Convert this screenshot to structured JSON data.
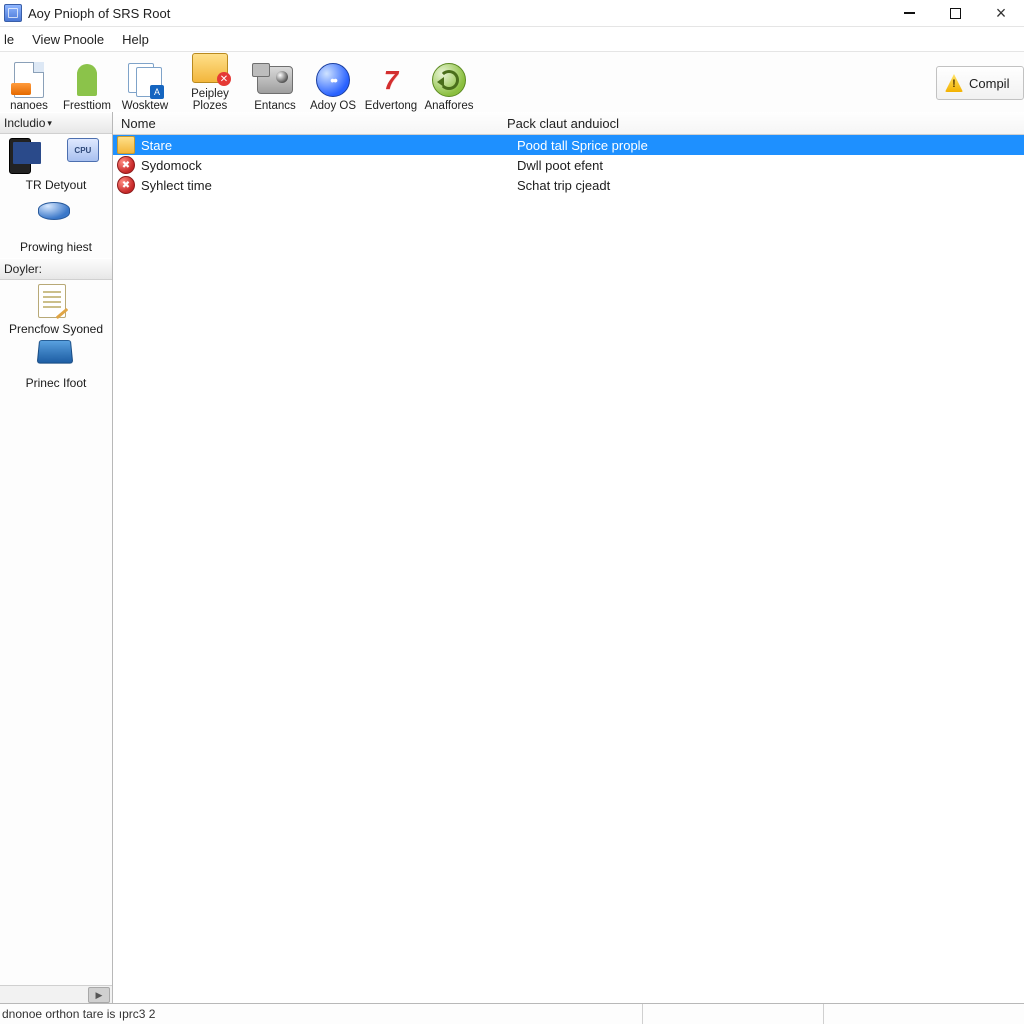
{
  "window": {
    "title": "Aoy Pnioph of SRS Root"
  },
  "menu": {
    "file": "le",
    "view": "View Pnoole",
    "help": "Help"
  },
  "toolbar": {
    "items": [
      {
        "label": "nanoes"
      },
      {
        "label": "Fresttiom"
      },
      {
        "label": "Wosktew"
      },
      {
        "label": "Peipley Plozes"
      },
      {
        "label": "Entancs"
      },
      {
        "label": "Adoy OS"
      },
      {
        "label": "Edvertong"
      },
      {
        "label": "Anaffores"
      }
    ],
    "compile_label": "Compil"
  },
  "sidebar": {
    "section1": {
      "title": "Includio",
      "items": [
        {
          "label": "TR Detyout"
        },
        {
          "label": "Prowing hiest"
        }
      ]
    },
    "section2": {
      "title": "Doyler:",
      "items": [
        {
          "label": "Prencfow Syoned"
        },
        {
          "label": "Prinec Ifoot"
        }
      ]
    }
  },
  "list": {
    "columns": {
      "name": "Nome",
      "desc": "Pack claut anduiocl"
    },
    "rows": [
      {
        "icon": "folder",
        "name": "Stare",
        "desc": "Pood tall Sprice prople",
        "selected": true
      },
      {
        "icon": "err",
        "name": "Sydomock",
        "desc": "Dwll poot efent",
        "selected": false
      },
      {
        "icon": "err",
        "name": "Syhlect time",
        "desc": "Schat trip cjeadt",
        "selected": false
      }
    ]
  },
  "statusbar": {
    "message": "dnonoe orthon tare is ıprc3 2"
  }
}
